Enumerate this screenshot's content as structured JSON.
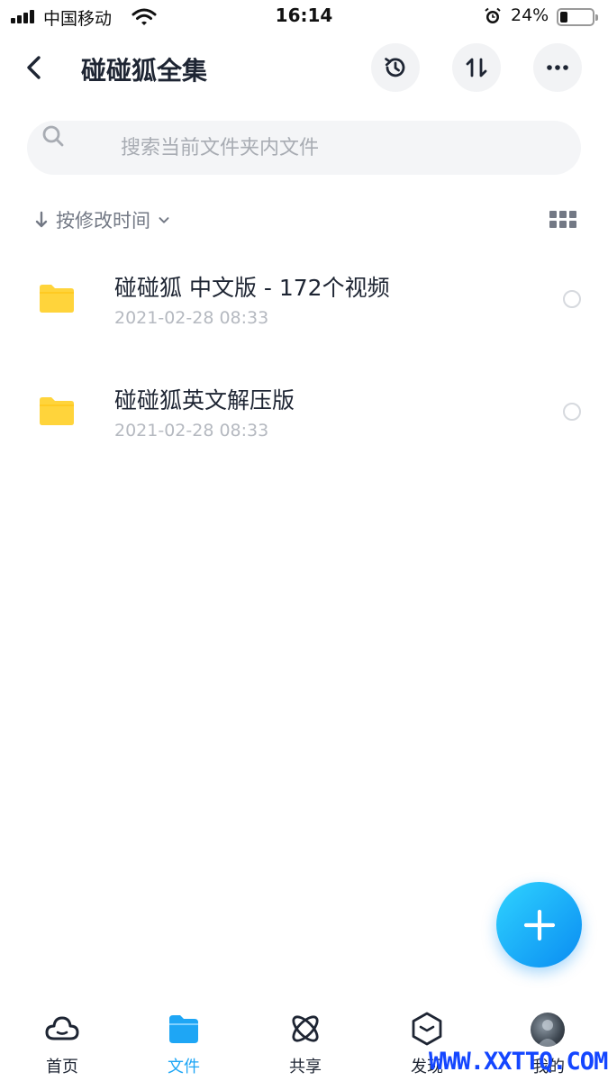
{
  "status_bar": {
    "carrier": "中国移动",
    "time": "16:14",
    "battery_percent": "24%",
    "battery_level": 0.24
  },
  "header": {
    "title": "碰碰狐全集"
  },
  "search": {
    "placeholder": "搜索当前文件夹内文件",
    "value": ""
  },
  "sort": {
    "label": "按修改时间"
  },
  "files": [
    {
      "name": "碰碰狐 中文版  - 172个视频",
      "modified": "2021-02-28 08:33"
    },
    {
      "name": "碰碰狐英文解压版",
      "modified": "2021-02-28 08:33"
    }
  ],
  "tabbar": {
    "tabs": [
      {
        "label": "首页",
        "icon": "cloud-icon"
      },
      {
        "label": "文件",
        "icon": "folder-icon",
        "active": true
      },
      {
        "label": "共享",
        "icon": "atom-icon"
      },
      {
        "label": "发现",
        "icon": "cube-icon"
      },
      {
        "label": "我的",
        "icon": "avatar"
      }
    ]
  },
  "watermark": "WWW.XXTTQ.COM",
  "colors": {
    "accent": "#1ea6f5",
    "folder": "#ffd43b",
    "fab_gradient_start": "#2fd3ff",
    "fab_gradient_end": "#0a8cf2"
  }
}
